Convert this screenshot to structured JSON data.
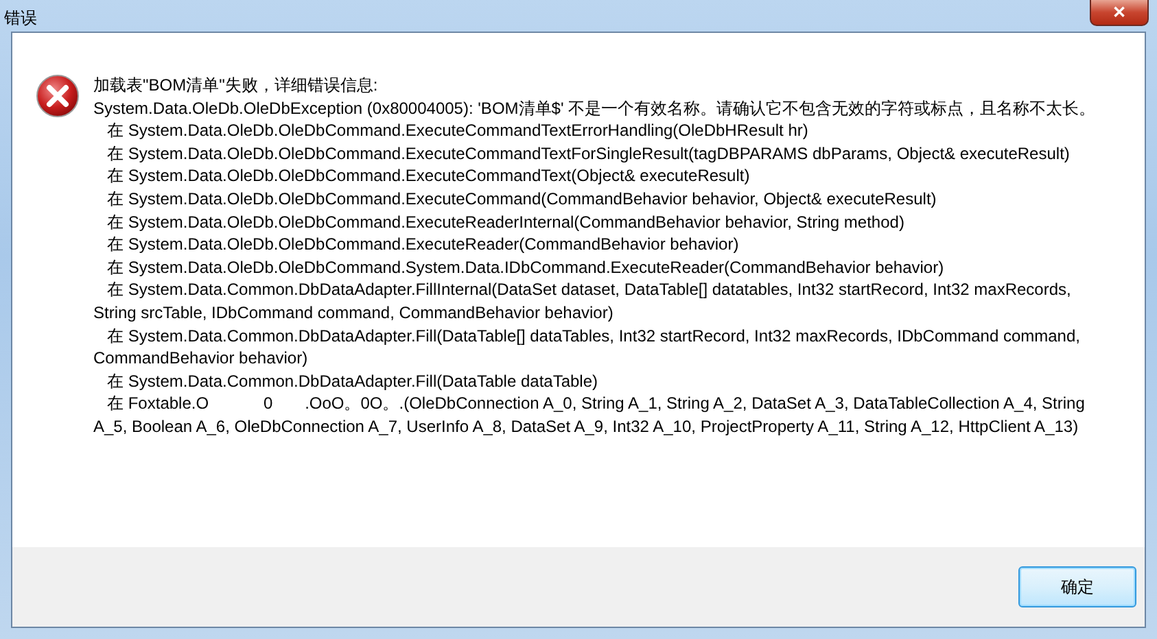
{
  "window": {
    "title": "错误",
    "close_glyph": "✕"
  },
  "message": {
    "heading": "加载表\"BOM清单\"失败，详细错误信息:",
    "lines": [
      "System.Data.OleDb.OleDbException (0x80004005): 'BOM清单$' 不是一个有效名称。请确认它不包含无效的字符或标点，且名称不太长。",
      "   在 System.Data.OleDb.OleDbCommand.ExecuteCommandTextErrorHandling(OleDbHResult hr)",
      "   在 System.Data.OleDb.OleDbCommand.ExecuteCommandTextForSingleResult(tagDBPARAMS dbParams, Object& executeResult)",
      "   在 System.Data.OleDb.OleDbCommand.ExecuteCommandText(Object& executeResult)",
      "   在 System.Data.OleDb.OleDbCommand.ExecuteCommand(CommandBehavior behavior, Object& executeResult)",
      "   在 System.Data.OleDb.OleDbCommand.ExecuteReaderInternal(CommandBehavior behavior, String method)",
      "   在 System.Data.OleDb.OleDbCommand.ExecuteReader(CommandBehavior behavior)",
      "   在 System.Data.OleDb.OleDbCommand.System.Data.IDbCommand.ExecuteReader(CommandBehavior behavior)",
      "   在 System.Data.Common.DbDataAdapter.FillInternal(DataSet dataset, DataTable[] datatables, Int32 startRecord, Int32 maxRecords, String srcTable, IDbCommand command, CommandBehavior behavior)",
      "   在 System.Data.Common.DbDataAdapter.Fill(DataTable[] dataTables, Int32 startRecord, Int32 maxRecords, IDbCommand command, CommandBehavior behavior)",
      "   在 System.Data.Common.DbDataAdapter.Fill(DataTable dataTable)",
      "   在 Foxtable.O            0       .OoO。0O。.(OleDbConnection A_0, String A_1, String A_2, DataSet A_3, DataTableCollection A_4, String A_5, Boolean A_6, OleDbConnection A_7, UserInfo A_8, DataSet A_9, Int32 A_10, ProjectProperty A_11, String A_12, HttpClient A_13)"
    ]
  },
  "buttons": [
    {
      "label": "确定",
      "kind": "default"
    }
  ]
}
